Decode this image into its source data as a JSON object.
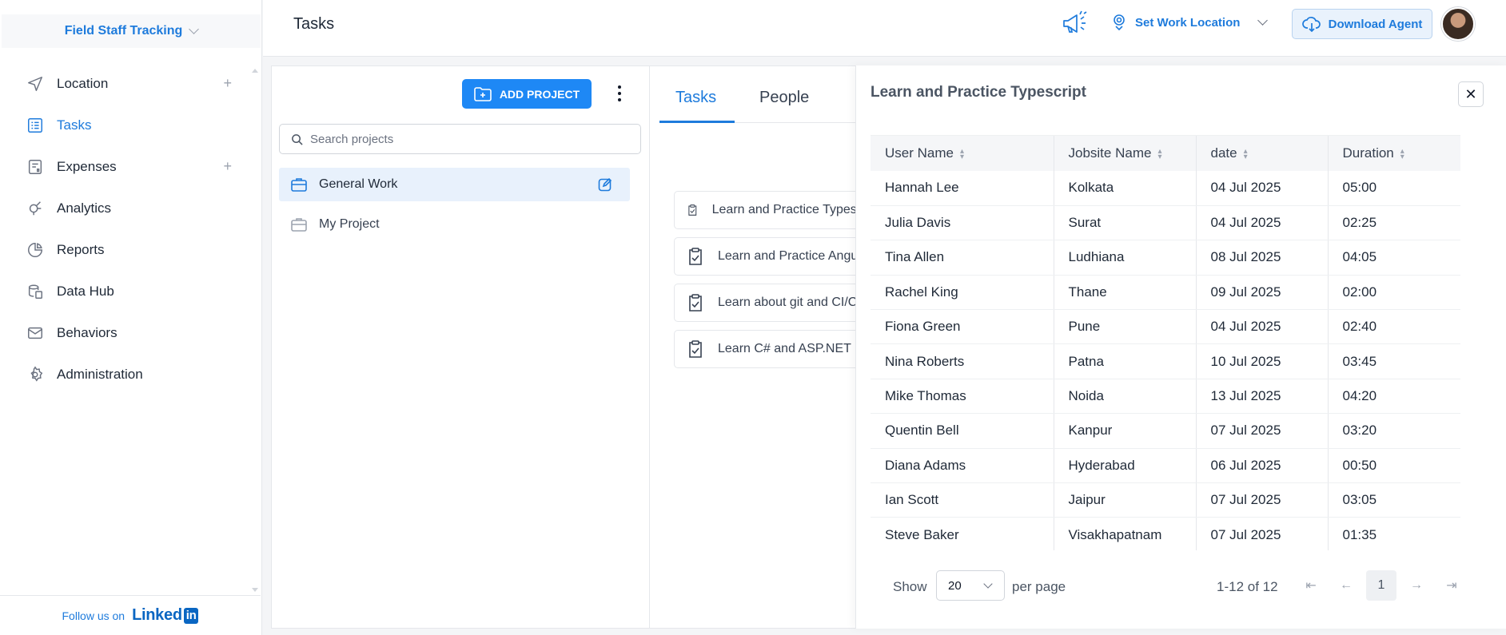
{
  "brand": {
    "name": "Field Staff Tracking"
  },
  "sidebar": {
    "items": [
      {
        "label": "Location",
        "icon": "location-arrow-icon",
        "has_add": true,
        "active": false
      },
      {
        "label": "Tasks",
        "icon": "tasks-icon",
        "has_add": false,
        "active": true
      },
      {
        "label": "Expenses",
        "icon": "expenses-icon",
        "has_add": true,
        "active": false
      },
      {
        "label": "Analytics",
        "icon": "analytics-icon",
        "has_add": false,
        "active": false
      },
      {
        "label": "Reports",
        "icon": "reports-icon",
        "has_add": false,
        "active": false
      },
      {
        "label": "Data Hub",
        "icon": "data-hub-icon",
        "has_add": false,
        "active": false
      },
      {
        "label": "Behaviors",
        "icon": "behaviors-icon",
        "has_add": false,
        "active": false
      },
      {
        "label": "Administration",
        "icon": "gear-icon",
        "has_add": false,
        "active": false
      }
    ],
    "add_symbol": "+",
    "follow_text": "Follow us on",
    "linkedin_text": "Linked",
    "linkedin_badge": "in"
  },
  "header": {
    "title": "Tasks",
    "work_location": "Set Work Location",
    "download": "Download Agent"
  },
  "projects": {
    "add_label": "ADD PROJECT",
    "search_placeholder": "Search projects",
    "items": [
      {
        "name": "General Work",
        "selected": true
      },
      {
        "name": "My Project",
        "selected": false
      }
    ]
  },
  "tabs": {
    "tasks": "Tasks",
    "people": "People"
  },
  "task_list": [
    "Learn and Practice Typescript",
    "Learn and Practice Angular",
    "Learn about git and CI/CD",
    "Learn C# and ASP.NET"
  ],
  "drawer": {
    "title": "Learn and Practice Typescript",
    "close_symbol": "✕",
    "columns": [
      "User Name",
      "Jobsite Name",
      "date",
      "Duration"
    ],
    "rows": [
      [
        "Hannah Lee",
        "Kolkata",
        "04 Jul 2025",
        "05:00"
      ],
      [
        "Julia Davis",
        "Surat",
        "04 Jul 2025",
        "02:25"
      ],
      [
        "Tina Allen",
        "Ludhiana",
        "08 Jul 2025",
        "04:05"
      ],
      [
        "Rachel King",
        "Thane",
        "09 Jul 2025",
        "02:00"
      ],
      [
        "Fiona Green",
        "Pune",
        "04 Jul 2025",
        "02:40"
      ],
      [
        "Nina Roberts",
        "Patna",
        "10 Jul 2025",
        "03:45"
      ],
      [
        "Mike Thomas",
        "Noida",
        "13 Jul 2025",
        "04:20"
      ],
      [
        "Quentin Bell",
        "Kanpur",
        "07 Jul 2025",
        "03:20"
      ],
      [
        "Diana Adams",
        "Hyderabad",
        "06 Jul 2025",
        "00:50"
      ],
      [
        "Ian Scott",
        "Jaipur",
        "07 Jul 2025",
        "03:05"
      ],
      [
        "Steve Baker",
        "Visakhapatnam",
        "07 Jul 2025",
        "01:35"
      ]
    ],
    "footer": {
      "show": "Show",
      "per_page_value": "20",
      "per_page": "per page",
      "range": "1-12 of 12",
      "current_page": "1"
    }
  },
  "colors": {
    "accent": "#1e7bdc",
    "button": "#1e88f5",
    "selected_bg": "#e8f1fc"
  }
}
